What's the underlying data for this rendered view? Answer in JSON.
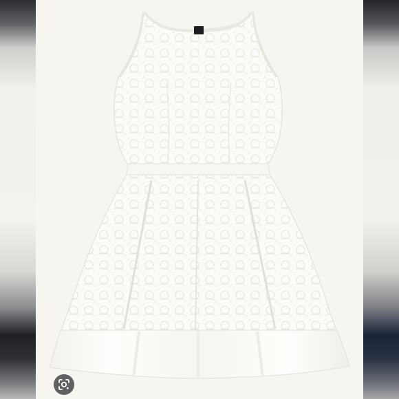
{
  "image": {
    "subject": "product-photo",
    "colors": {
      "background": "#f6f5f0",
      "dress": "#fbfbf8",
      "lace_shadow": "#e9e8e2",
      "satin_hem": "#fdfdfb",
      "label": "#1e1e22"
    }
  },
  "overlay": {
    "icon": "lens-search-icon"
  }
}
